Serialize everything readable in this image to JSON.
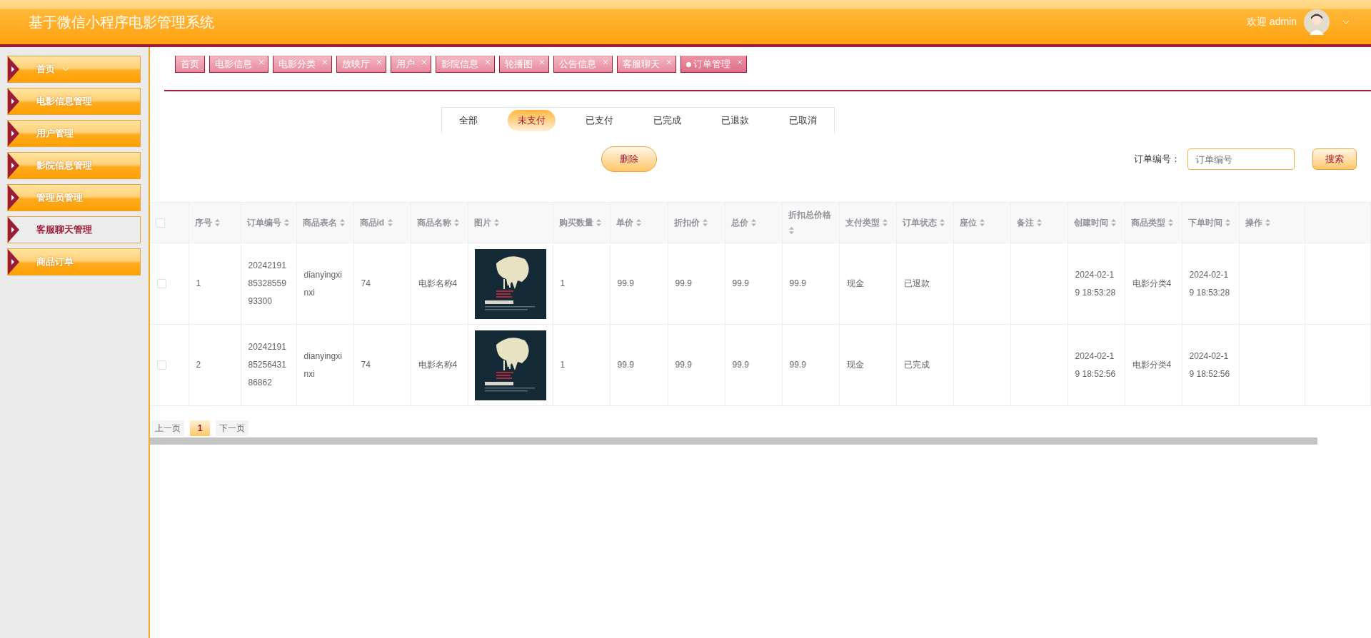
{
  "header": {
    "title": "基于微信小程序电影管理系统",
    "welcome": "欢迎 admin"
  },
  "sidebar": {
    "items": [
      {
        "label": "首页",
        "kind": "submenu",
        "selected": false
      },
      {
        "label": "电影信息管理",
        "kind": "link",
        "selected": false
      },
      {
        "label": "用户管理",
        "kind": "link",
        "selected": false
      },
      {
        "label": "影院信息管理",
        "kind": "link",
        "selected": false
      },
      {
        "label": "管理员管理",
        "kind": "link",
        "selected": false
      },
      {
        "label": "客服聊天管理",
        "kind": "link",
        "selected": true
      },
      {
        "label": "商品订单",
        "kind": "link",
        "selected": false
      }
    ]
  },
  "tabs": [
    {
      "label": "首页",
      "closable": false,
      "selected": false
    },
    {
      "label": "电影信息",
      "closable": true,
      "selected": false
    },
    {
      "label": "电影分类",
      "closable": true,
      "selected": false
    },
    {
      "label": "放映厅",
      "closable": true,
      "selected": false
    },
    {
      "label": "用户",
      "closable": true,
      "selected": false
    },
    {
      "label": "影院信息",
      "closable": true,
      "selected": false
    },
    {
      "label": "轮播图",
      "closable": true,
      "selected": false
    },
    {
      "label": "公告信息",
      "closable": true,
      "selected": false
    },
    {
      "label": "客服聊天",
      "closable": true,
      "selected": false
    },
    {
      "label": "订单管理",
      "closable": true,
      "selected": true
    }
  ],
  "status_tabs": [
    {
      "label": "全部",
      "selected": false
    },
    {
      "label": "未支付",
      "selected": true
    },
    {
      "label": "已支付",
      "selected": false
    },
    {
      "label": "已完成",
      "selected": false
    },
    {
      "label": "已退款",
      "selected": false
    },
    {
      "label": "已取消",
      "selected": false
    }
  ],
  "toolbar": {
    "delete_button": "删除",
    "search_label": "订单编号：",
    "search_field": {
      "placeholder": "订单编号"
    },
    "search_button": "搜索"
  },
  "table": {
    "select_all": {
      "checked": false
    },
    "columns": [
      "序号",
      "订单编号",
      "商品表名",
      "商品id",
      "商品名称",
      "图片",
      "购买数量",
      "单价",
      "折扣价",
      "总价",
      "折扣总价格",
      "支付类型",
      "订单状态",
      "座位",
      "备注",
      "创建时间",
      "商品类型",
      "下单时间",
      "操作"
    ],
    "rows": [
      {
        "selected": false,
        "cells": [
          "1",
          "202421918532855993300",
          "dianyingxinxi",
          "74",
          "电影名称4",
          {
            "kind": "picture"
          },
          "1",
          "99.9",
          "99.9",
          "99.9",
          "99.9",
          "现金",
          "已退款",
          null,
          null,
          "2024-02-19 18:53:28",
          "电影分类4",
          "2024-02-19 18:53:28",
          null
        ]
      },
      {
        "selected": false,
        "cells": [
          "2",
          "202421918525643186862",
          "dianyingxinxi",
          "74",
          "电影名称4",
          {
            "kind": "picture"
          },
          "1",
          "99.9",
          "99.9",
          "99.9",
          "99.9",
          "现金",
          "已完成",
          null,
          null,
          "2024-02-19 18:52:56",
          "电影分类4",
          "2024-02-19 18:52:56",
          null
        ]
      }
    ]
  },
  "pagination": {
    "prev": "上一页",
    "pages": [
      {
        "label": "1",
        "selected": true
      }
    ],
    "next": "下一页"
  }
}
